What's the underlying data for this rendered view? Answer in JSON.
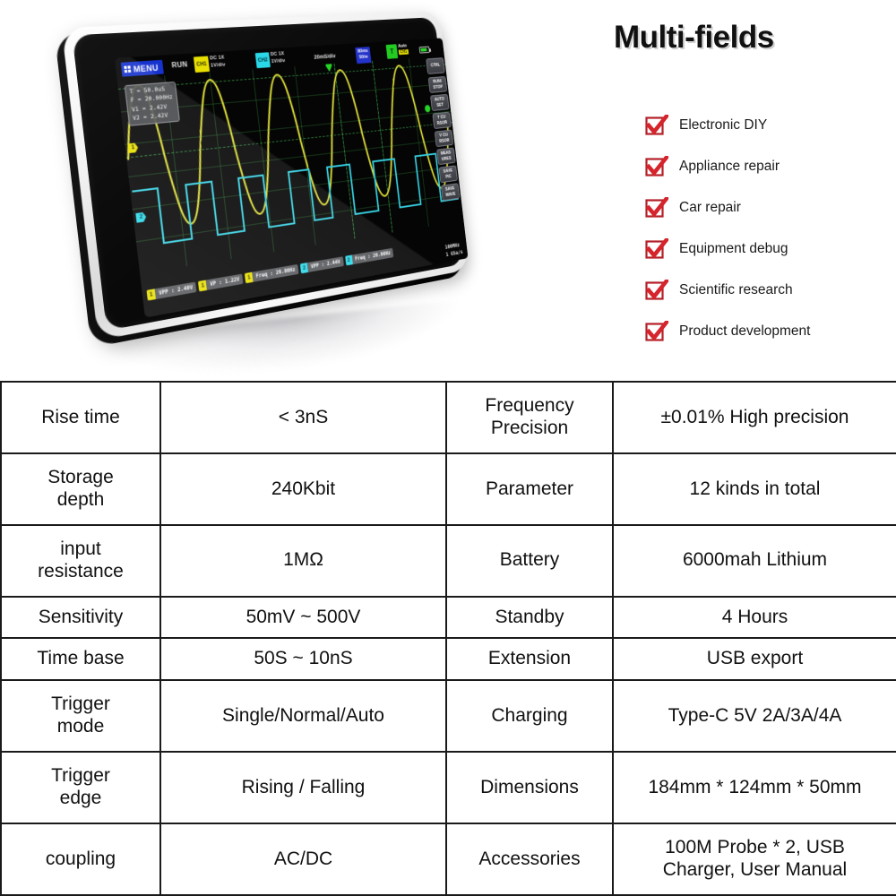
{
  "hero": {
    "title": "Multi-fields",
    "checklist": [
      {
        "label": "Electronic DIY"
      },
      {
        "label": "Appliance repair"
      },
      {
        "label": "Car repair"
      },
      {
        "label": "Equipment debug"
      },
      {
        "label": "Scientific research"
      },
      {
        "label": "Product development"
      }
    ],
    "check_color": "#c8232c"
  },
  "device": {
    "screen": {
      "menu_label": "MENU",
      "run_label": "RUN",
      "ch1": {
        "name": "CH1",
        "coupling": "DC  1X",
        "scale": "1V/div",
        "color": "#e8e000"
      },
      "ch2": {
        "name": "CH2",
        "coupling": "DC  1X",
        "scale": "1V/div",
        "color": "#2ad8e8"
      },
      "timebase": "20mS/div",
      "blue_chip_line1": "80ms",
      "blue_chip_line2": "50/w",
      "trigger": {
        "symbol": "T",
        "mode": "Auto",
        "source": "CH1"
      },
      "readout": [
        "T  = 50.0uS",
        "F  = 20.000Hz",
        "V1 =  2.42V",
        "V2 =  2.42V"
      ],
      "measurements": [
        {
          "ch": "1",
          "text": "VPP : 2.40V",
          "color": "#e8e000"
        },
        {
          "ch": "1",
          "text": "VP : 1.22V",
          "color": "#e8e000"
        },
        {
          "ch": "1",
          "text": "Freq : 20.00Hz",
          "color": "#e8e000"
        },
        {
          "ch": "2",
          "text": "VPP : 2.44V",
          "color": "#2ad8e8"
        },
        {
          "ch": "2",
          "text": "Freq : 20.00Hz",
          "color": "#2ad8e8"
        }
      ],
      "spec_corner": [
        "100MHz",
        "1  GSa/s"
      ],
      "softkeys": [
        {
          "l1": "CTRL",
          "l2": ""
        },
        {
          "l1": "RUN/",
          "l2": "STOP"
        },
        {
          "l1": "AUTO",
          "l2": "SET"
        },
        {
          "l1": "T CU",
          "l2": "RSOR"
        },
        {
          "l1": "V CU",
          "l2": "RSOR"
        },
        {
          "l1": "MEAS",
          "l2": "URES"
        },
        {
          "l1": "SAVE",
          "l2": "PIC"
        },
        {
          "l1": "SAVE",
          "l2": "WAVE"
        }
      ],
      "marker_ch1": "1",
      "marker_ch2": "2"
    }
  },
  "spec_table": {
    "rows": [
      {
        "k1": "Rise time",
        "v1": "< 3nS",
        "k2": "Frequency\nPrecision",
        "v2": "±0.01% High precision"
      },
      {
        "k1": "Storage\ndepth",
        "v1": "240Kbit",
        "k2": "Parameter",
        "v2": "12 kinds in total"
      },
      {
        "k1": "input\nresistance",
        "v1": "1MΩ",
        "k2": "Battery",
        "v2": "6000mah Lithium"
      },
      {
        "k1": "Sensitivity",
        "v1": "50mV ~ 500V",
        "k2": "Standby",
        "v2": "4  Hours"
      },
      {
        "k1": "Time base",
        "v1": "50S ~ 10nS",
        "k2": "Extension",
        "v2": "USB export"
      },
      {
        "k1": "Trigger\nmode",
        "v1": "Single/Normal/Auto",
        "k2": "Charging",
        "v2": "Type-C   5V  2A/3A/4A"
      },
      {
        "k1": "Trigger\nedge",
        "v1": "Rising / Falling",
        "k2": "Dimensions",
        "v2": "184mm * 124mm * 50mm"
      },
      {
        "k1": "coupling",
        "v1": "AC/DC",
        "k2": "Accessories",
        "v2": "100M Probe * 2,  USB\nCharger,  User Manual"
      }
    ]
  }
}
